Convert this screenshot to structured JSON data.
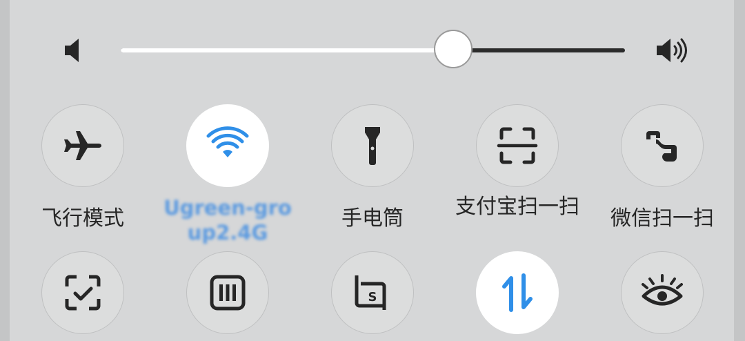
{
  "volume": {
    "level": 0.66,
    "low_icon": "volume-low-icon",
    "high_icon": "volume-high-icon"
  },
  "tiles": [
    {
      "icon": "airplane-icon",
      "label": "飞行模式",
      "active": false
    },
    {
      "icon": "wifi-icon",
      "label": "Ugreen-group2.4G",
      "active": true
    },
    {
      "icon": "flashlight-icon",
      "label": "手电筒",
      "active": false
    },
    {
      "icon": "scan-icon",
      "label": "支付宝扫一扫",
      "active": false
    },
    {
      "icon": "wechat-scan-icon",
      "label": "微信扫一扫",
      "active": false
    },
    {
      "icon": "screenshot-check-icon",
      "label": "",
      "active": false
    },
    {
      "icon": "memory-icon",
      "label": "",
      "active": false
    },
    {
      "icon": "scroll-screenshot-icon",
      "label": "",
      "active": false
    },
    {
      "icon": "mobile-data-icon",
      "label": "",
      "active": true
    },
    {
      "icon": "eye-comfort-icon",
      "label": "",
      "active": false
    }
  ],
  "colors": {
    "panel_bg": "#d6d7d8",
    "accent_blue": "#2f8fe8",
    "icon_dark": "#262626"
  }
}
